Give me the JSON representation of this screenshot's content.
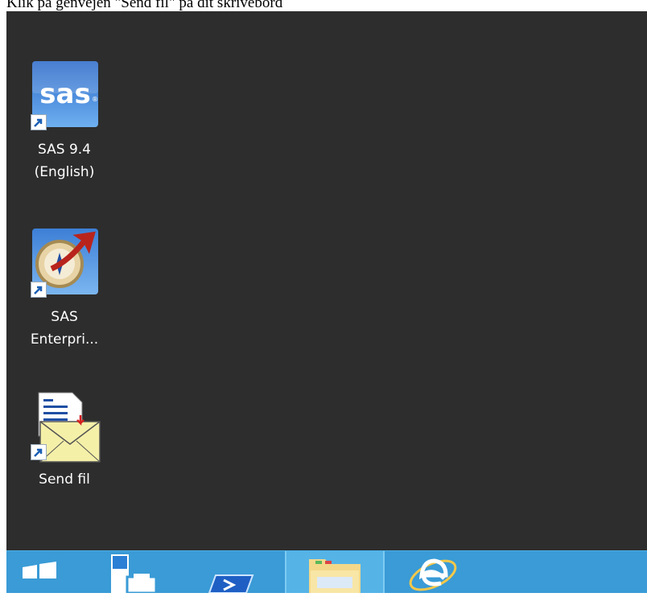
{
  "instruction": "Klik på genvejen \"Send fil\" på dit skrivebord",
  "desktop": {
    "icons": [
      {
        "label": "SAS 9.4\n(English)",
        "icon": "sas-logo-icon"
      },
      {
        "label": "SAS\nEnterpri...",
        "icon": "sas-enterprise-guide-icon"
      },
      {
        "label": "Send fil",
        "icon": "send-file-envelope-icon"
      }
    ]
  },
  "taskbar": {
    "items": [
      {
        "name": "start",
        "icon": "windows-start-icon"
      },
      {
        "name": "server-manager",
        "icon": "server-manager-icon"
      },
      {
        "name": "powershell",
        "icon": "powershell-icon"
      },
      {
        "name": "file-explorer",
        "icon": "folder-icon"
      },
      {
        "name": "internet-explorer",
        "icon": "internet-explorer-icon"
      }
    ]
  },
  "colors": {
    "desktop_background": "#2d2d2d",
    "taskbar": "#3a9bd6",
    "icon_text": "#ffffff"
  }
}
